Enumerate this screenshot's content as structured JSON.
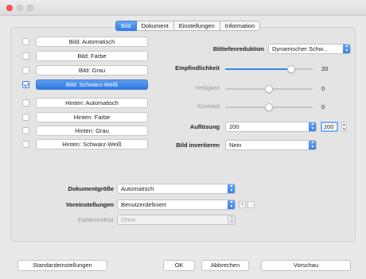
{
  "tabs": [
    "Bild",
    "Dokument",
    "Einstellungen",
    "Information"
  ],
  "active_tab": "Bild",
  "image_list": [
    {
      "label": "Bild: Automatisch",
      "checked": false,
      "selected": false
    },
    {
      "label": "Bild: Farbe",
      "checked": false,
      "selected": false
    },
    {
      "label": "Bild: Grau",
      "checked": false,
      "selected": false
    },
    {
      "label": "Bild: Schwarz-Weiß",
      "checked": true,
      "selected": true
    },
    {
      "label": "Hinten: Automatisch",
      "checked": false,
      "selected": false
    },
    {
      "label": "Hinten: Farbe",
      "checked": false,
      "selected": false
    },
    {
      "label": "Hinten: Grau",
      "checked": false,
      "selected": false
    },
    {
      "label": "Hinten: Schwarz-Weiß",
      "checked": false,
      "selected": false
    }
  ],
  "settings": {
    "bittiefe": {
      "label": "Bittiefenreduktion",
      "value": "Dynamischer Schw..."
    },
    "empfindlichkeit": {
      "label": "Empfindlichkeit",
      "value": "20",
      "level": 0.75
    },
    "helligkeit": {
      "label": "Helligkeit",
      "value": "0",
      "level": 0.5
    },
    "kontrast": {
      "label": "Kontrast",
      "value": "0",
      "level": 0.5
    },
    "aufloesung": {
      "label": "Auflösung",
      "value": "200",
      "custom": "200"
    },
    "invertieren": {
      "label": "Bild invertieren",
      "value": "Nein"
    }
  },
  "document": {
    "groesse": {
      "label": "Dokumentgröße",
      "value": "Automatisch"
    },
    "voreinstellungen": {
      "label": "Voreinstellungen",
      "value": "Benutzerdefiniert",
      "add": "+",
      "remove": "−"
    },
    "farbkorrektur": {
      "label": "Farbkorrektur",
      "value": "Ohne"
    }
  },
  "buttons": {
    "defaults": "Standardeinstellungen",
    "ok": "OK",
    "cancel": "Abbrechen",
    "preview": "Vorschau"
  },
  "colors": {
    "accent": "#2f7ee9",
    "close": "#fc5753"
  }
}
